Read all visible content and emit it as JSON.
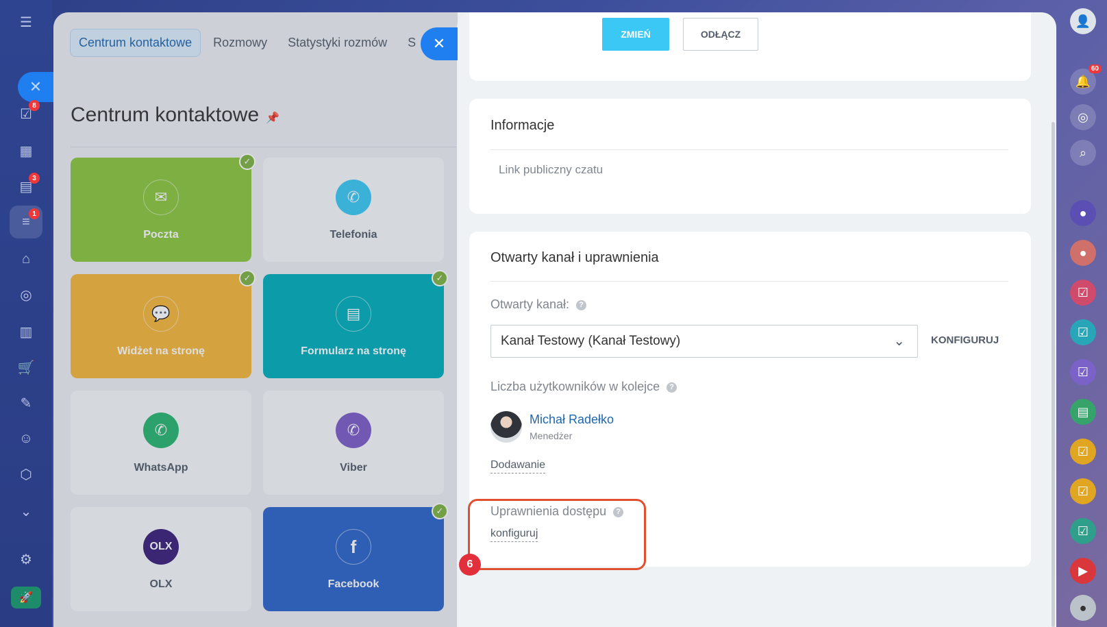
{
  "colors": {
    "accent_blue": "#3bc8f5",
    "link_blue": "#2067b0",
    "highlight": "#e1502e",
    "badge_red": "#e12f3c"
  },
  "left_rail": {
    "badges": {
      "tasks": "8",
      "crm": "3",
      "contact_center": "1"
    }
  },
  "background_page": {
    "tabs": [
      "Centrum kontaktowe",
      "Rozmowy",
      "Statystyki rozmów",
      "S"
    ],
    "title": "Centrum kontaktowe",
    "tiles": [
      {
        "label": "Poczta",
        "icon": "envelope-icon",
        "glyph": "✉"
      },
      {
        "label": "Telefonia",
        "icon": "phone-icon",
        "glyph": "✆"
      },
      {
        "label": "Widżet na stronę",
        "icon": "chat-bubbles-icon",
        "glyph": "💬"
      },
      {
        "label": "Formularz na stronę",
        "icon": "form-icon",
        "glyph": "▤"
      },
      {
        "label": "WhatsApp",
        "icon": "whatsapp-icon",
        "glyph": "✆"
      },
      {
        "label": "Viber",
        "icon": "viber-icon",
        "glyph": "✆"
      },
      {
        "label": "OLX",
        "icon": "olx-logo-icon",
        "glyph": "OLX"
      },
      {
        "label": "Facebook",
        "icon": "facebook-icon",
        "glyph": "f"
      }
    ]
  },
  "slider": {
    "top_buttons": {
      "change": "ZMIEŃ",
      "disconnect": "ODŁĄCZ"
    },
    "info_card": {
      "title": "Informacje",
      "public_link_label": "Link publiczny czatu"
    },
    "channel_card": {
      "title": "Otwarty kanał i uprawnienia",
      "open_channel_label": "Otwarty kanał:",
      "open_channel_value": "Kanał Testowy (Kanał Testowy)",
      "configure_link": "KONFIGURUJ",
      "queue_users_label": "Liczba użytkowników w kolejce",
      "user": {
        "name": "Michał Radełko",
        "role": "Menedżer"
      },
      "add_link": "Dodawanie",
      "access_rights_label": "Uprawnienia dostępu",
      "access_rights_configure": "konfiguruj"
    },
    "step_number": "6"
  },
  "right_rail": {
    "notifications_count": "60"
  }
}
